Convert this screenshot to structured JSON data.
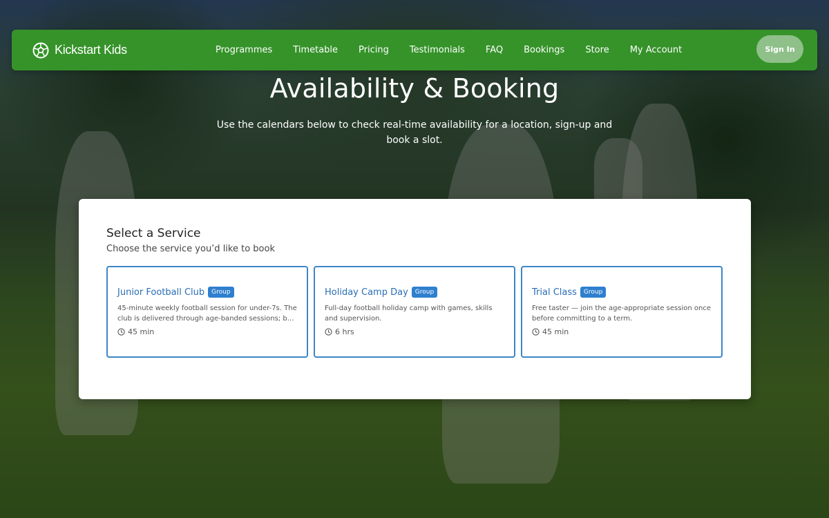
{
  "brand": {
    "name": "Kickstart Kids",
    "icon": "football-icon"
  },
  "nav": {
    "items": [
      "Programmes",
      "Timetable",
      "Pricing",
      "Testimonials",
      "FAQ",
      "Bookings",
      "Store",
      "My Account"
    ],
    "signin_label": "Sign In"
  },
  "hero": {
    "title": "Availability & Booking",
    "subtitle": "Use the calendars below to check real-time availability for a location, sign-up and book a slot."
  },
  "service_panel": {
    "title": "Select a Service",
    "subtitle": "Choose the service you’d like to book",
    "cards": [
      {
        "title": "Junior Football Club",
        "badge": "Group",
        "description": "45-minute weekly football session for under-7s. The club is delivered through age-banded sessions; b…",
        "duration": "45 min"
      },
      {
        "title": "Holiday Camp Day",
        "badge": "Group",
        "description": "Full-day football holiday camp with games, skills and supervision.",
        "duration": "6 hrs"
      },
      {
        "title": "Trial Class",
        "badge": "Group",
        "description": "Free taster — join the age-appropriate session once before committing to a term.",
        "duration": "45 min"
      }
    ]
  },
  "colors": {
    "navbar": "#36932a",
    "signin_button": "#8fc08a",
    "card_border": "#3c86c6",
    "card_title": "#2a6db6",
    "badge": "#2f7fcf"
  }
}
